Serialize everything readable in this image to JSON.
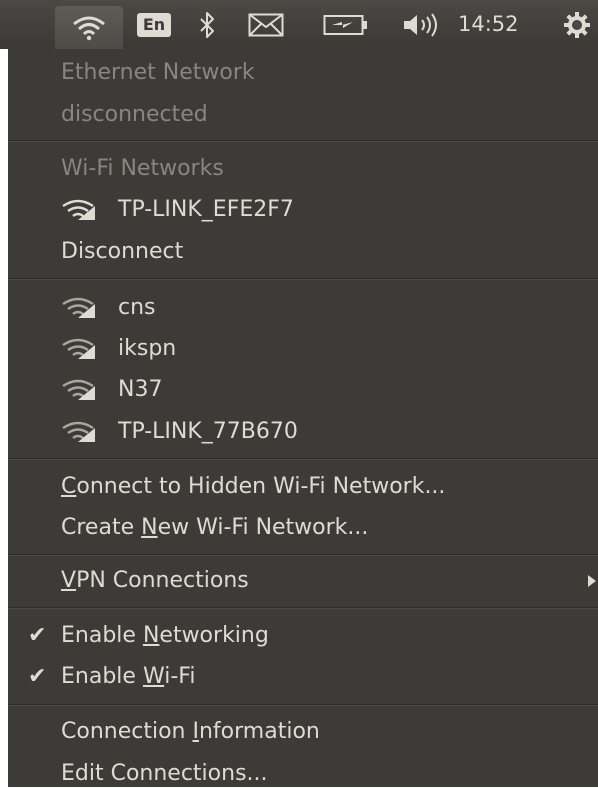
{
  "panel": {
    "input_method": "En",
    "clock": "14:52"
  },
  "menu": {
    "ethernet_header": "Ethernet Network",
    "ethernet_status": "disconnected",
    "wifi_header": "Wi-Fi Networks",
    "connected_network": "TP-LINK_EFE2F7",
    "disconnect": "Disconnect",
    "available_networks": [
      {
        "ssid": "cns"
      },
      {
        "ssid": "ikspn"
      },
      {
        "ssid": "N37"
      },
      {
        "ssid": "TP-LINK_77B670"
      }
    ],
    "connect_hidden": {
      "pre": "",
      "mnemonic": "C",
      "post": "onnect to Hidden Wi-Fi Network..."
    },
    "create_new": {
      "pre": "Create ",
      "mnemonic": "N",
      "post": "ew Wi-Fi Network..."
    },
    "vpn": {
      "pre": "",
      "mnemonic": "V",
      "post": "PN Connections"
    },
    "enable_networking": {
      "pre": "Enable ",
      "mnemonic": "N",
      "post": "etworking",
      "checked": true
    },
    "enable_wifi": {
      "pre": "Enable ",
      "mnemonic": "W",
      "post": "i-Fi",
      "checked": true
    },
    "connection_info": {
      "pre": "Connection ",
      "mnemonic": "I",
      "post": "nformation"
    },
    "edit_connections": "Edit Connections...",
    "check_glyph": "✔"
  },
  "colors": {
    "menu_bg": "#3c3b37",
    "text": "#dfdbd2",
    "disabled_text": "#88867f",
    "panel_bg": "#3c3b37"
  }
}
